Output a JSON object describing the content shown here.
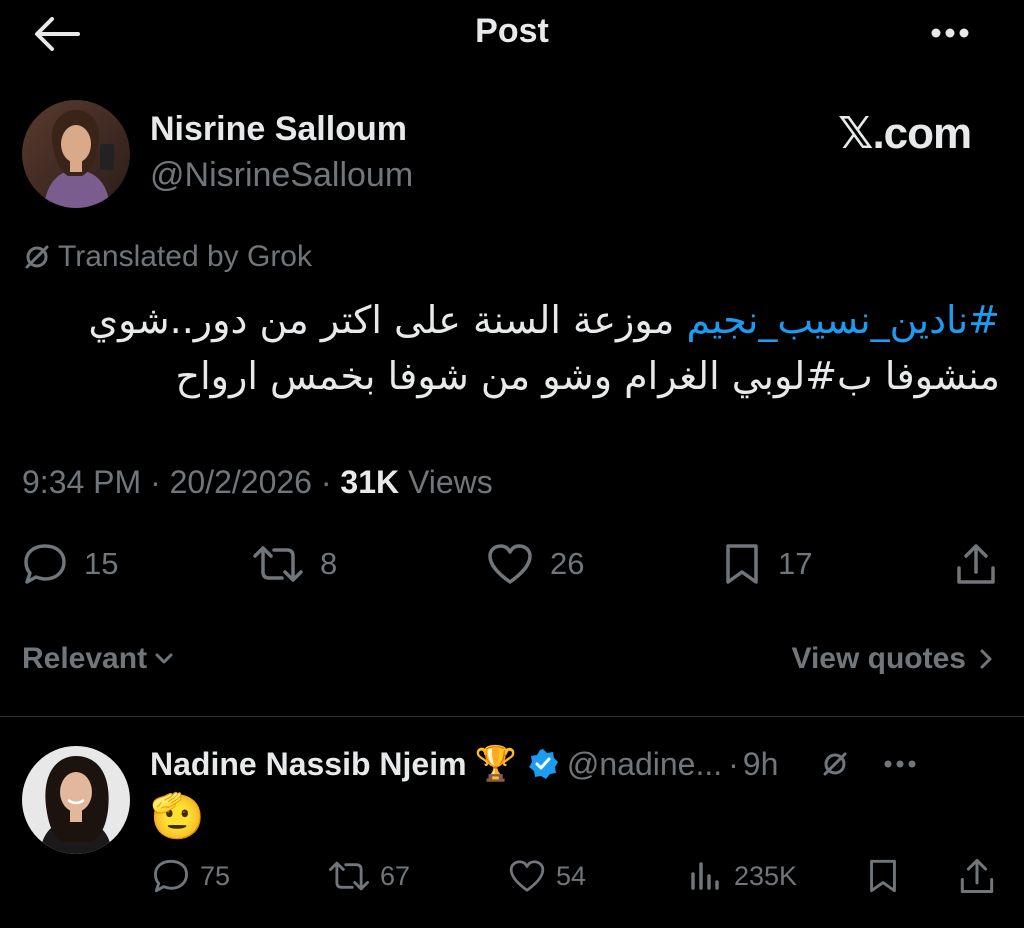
{
  "header": {
    "title": "Post",
    "back_icon": "arrow-left-icon",
    "more_icon": "more-horizontal-icon"
  },
  "post": {
    "author_name": "Nisrine Salloum",
    "author_handle": "@NisrineSalloum",
    "watermark": "𝕏.com",
    "translated_label": "Translated by Grok",
    "text": {
      "hashtag1": "#نادين_نسيب_نجيم",
      "line1_rest": " موزعة السنة على اكتر من دور..شوي",
      "line2_start": "منشوفا ب",
      "hashtag2": "#لوبي",
      "line2_rest": " الغرام وشو من شوفا بخمس ارواح"
    },
    "time": "9:34 PM",
    "date": "20/2/2026",
    "views_count": "31K",
    "views_label": "Views",
    "actions": {
      "replies": "15",
      "reposts": "8",
      "likes": "26",
      "bookmarks": "17"
    }
  },
  "filters": {
    "sort_label": "Relevant",
    "view_quotes_label": "View quotes"
  },
  "reply": {
    "author_name": "Nadine Nassib Njeim",
    "trophy": "🏆",
    "handle": "@nadine...",
    "dot": "·",
    "time": "9h",
    "emoji": "🫡",
    "actions": {
      "replies": "75",
      "reposts": "67",
      "likes": "54",
      "views": "235K"
    }
  },
  "colors": {
    "background": "#000000",
    "text": "#e7e9ea",
    "muted": "#71767b",
    "hashtag": "#1d9bf0",
    "verified": "#1d9bf0",
    "divider": "#2f3336"
  }
}
